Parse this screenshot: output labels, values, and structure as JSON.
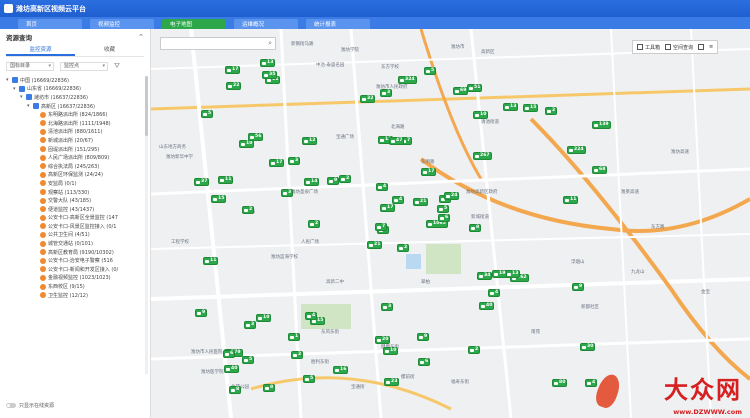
{
  "app": {
    "title": "潍坊高新区视频云平台"
  },
  "tabs": [
    {
      "label": "首页",
      "active": false
    },
    {
      "label": "视频监控",
      "active": false
    },
    {
      "label": "电子地图",
      "active": true
    },
    {
      "label": "运维概况",
      "active": false
    },
    {
      "label": "统计报表",
      "active": false
    }
  ],
  "panel": {
    "title": "资源查询",
    "tabs": [
      "监控资源",
      "收藏"
    ],
    "filter_left": "国标目录",
    "filter_right": "监控点",
    "footer_label": "只显示在线资源",
    "tree": [
      {
        "label": "中国 (16669/22836)",
        "indent": 0,
        "type": "org",
        "expanded": true
      },
      {
        "label": "山东省 (16669/22836)",
        "indent": 1,
        "type": "org",
        "expanded": true
      },
      {
        "label": "潍坊市 (16637/22836)",
        "indent": 2,
        "type": "org",
        "expanded": true
      },
      {
        "label": "高新区 (16637/22836)",
        "indent": 3,
        "type": "org",
        "expanded": true
      },
      {
        "label": "东明路派出所 (824/1866)",
        "indent": 4,
        "type": "cam"
      },
      {
        "label": "北海路派出所 (1111/1948)",
        "indent": 4,
        "type": "cam"
      },
      {
        "label": "清池派出所 (880/1611)",
        "indent": 4,
        "type": "cam"
      },
      {
        "label": "新城派出所 (20/67)",
        "indent": 4,
        "type": "cam"
      },
      {
        "label": "固堤派出所 (151/295)",
        "indent": 4,
        "type": "cam"
      },
      {
        "label": "人民广场派出所 (809/809)",
        "indent": 4,
        "type": "cam"
      },
      {
        "label": "综合执法局 (245/263)",
        "indent": 4,
        "type": "cam"
      },
      {
        "label": "高新区环保监测 (24/24)",
        "indent": 4,
        "type": "cam"
      },
      {
        "label": "安监局 (0/1)",
        "indent": 4,
        "type": "cam"
      },
      {
        "label": "观察站 (113/330)",
        "indent": 4,
        "type": "cam"
      },
      {
        "label": "交警大队 (43/185)",
        "indent": 4,
        "type": "cam"
      },
      {
        "label": "便道监控 (43/1437)",
        "indent": 4,
        "type": "cam"
      },
      {
        "label": "公安卡口-高新区全景监控 (147",
        "indent": 4,
        "type": "cam"
      },
      {
        "label": "公安卡口-风景区监控接入 (0/1",
        "indent": 4,
        "type": "cam"
      },
      {
        "label": "公共卫生间 (4/51)",
        "indent": 4,
        "type": "cam"
      },
      {
        "label": "城管交通站 (0/101)",
        "indent": 4,
        "type": "cam"
      },
      {
        "label": "高新区教育局 (9190/10302)",
        "indent": 4,
        "type": "cam"
      },
      {
        "label": "公安卡口-治安电子警察 (516",
        "indent": 4,
        "type": "cam"
      },
      {
        "label": "公安卡口-新闻和开发区接入 (0/",
        "indent": 4,
        "type": "cam"
      },
      {
        "label": "金融视频监控 (1023/1023)",
        "indent": 4,
        "type": "cam"
      },
      {
        "label": "东西校区 (9/15)",
        "indent": 4,
        "type": "cam"
      },
      {
        "label": "卫生监控 (12/12)",
        "indent": 4,
        "type": "cam"
      }
    ]
  },
  "search": {
    "placeholder": "",
    "value": ""
  },
  "toolbox": {
    "tools_label": "工具箱",
    "query_label": "空间查询"
  },
  "map": {
    "labels": [
      "小福",
      "新钢街马路",
      "潍坊学院",
      "东方学校",
      "潍坊市",
      "中冶·泰盛名园",
      "潍坊市人民政府",
      "高新区",
      "山东地方商务",
      "潍坊新华中学",
      "宝通广场",
      "北海路",
      "清池街道",
      "东明路",
      "新城街道",
      "潍坊高新区政府",
      "潍坊圣泉广场",
      "蓝海",
      "人民广场",
      "潍坊蓝海学校",
      "高新二中",
      "翠柏",
      "东风东街",
      "健康东街",
      "胜利东街",
      "宝通街",
      "樱前街",
      "福寿东街",
      "潍坊市人民医院",
      "潍坊医学院",
      "北苑公园",
      "工程学校",
      "浮烟山",
      "九龙山",
      "南苑",
      "新都社区",
      "东方路",
      "金宝",
      "潍坊高速",
      "潍莱高速"
    ],
    "markers": [
      "2",
      "10",
      "6",
      "279",
      "9",
      "15",
      "51",
      "7",
      "10",
      "1065",
      "11",
      "4",
      "2",
      "139",
      "21",
      "267",
      "8",
      "13",
      "17",
      "10",
      "2",
      "40",
      "2",
      "47",
      "24",
      "162",
      "56",
      "3",
      "15",
      "34",
      "68",
      "7",
      "20",
      "17",
      "12",
      "13",
      "4",
      "80",
      "30",
      "13",
      "5",
      "9",
      "3",
      "40",
      "5",
      "37",
      "5",
      "8",
      "10",
      "6",
      "3",
      "224",
      "5",
      "4",
      "2",
      "1",
      "35",
      "17",
      "9",
      "2",
      "324",
      "2",
      "11",
      "3",
      "15",
      "13",
      "69",
      "32",
      "4",
      "9",
      "3",
      "16",
      "19",
      "14",
      "6",
      "22",
      "17",
      "11",
      "4",
      "6",
      "21",
      "5",
      "8",
      "9",
      "23",
      "11"
    ]
  },
  "watermark": {
    "brand": "大众网",
    "url": "www.DZWWW.com"
  },
  "colors": {
    "titlebar": "#2b6ee0",
    "tab_active": "#2ca84a",
    "marker": "#2ca84a",
    "watermark": "#d62020"
  }
}
